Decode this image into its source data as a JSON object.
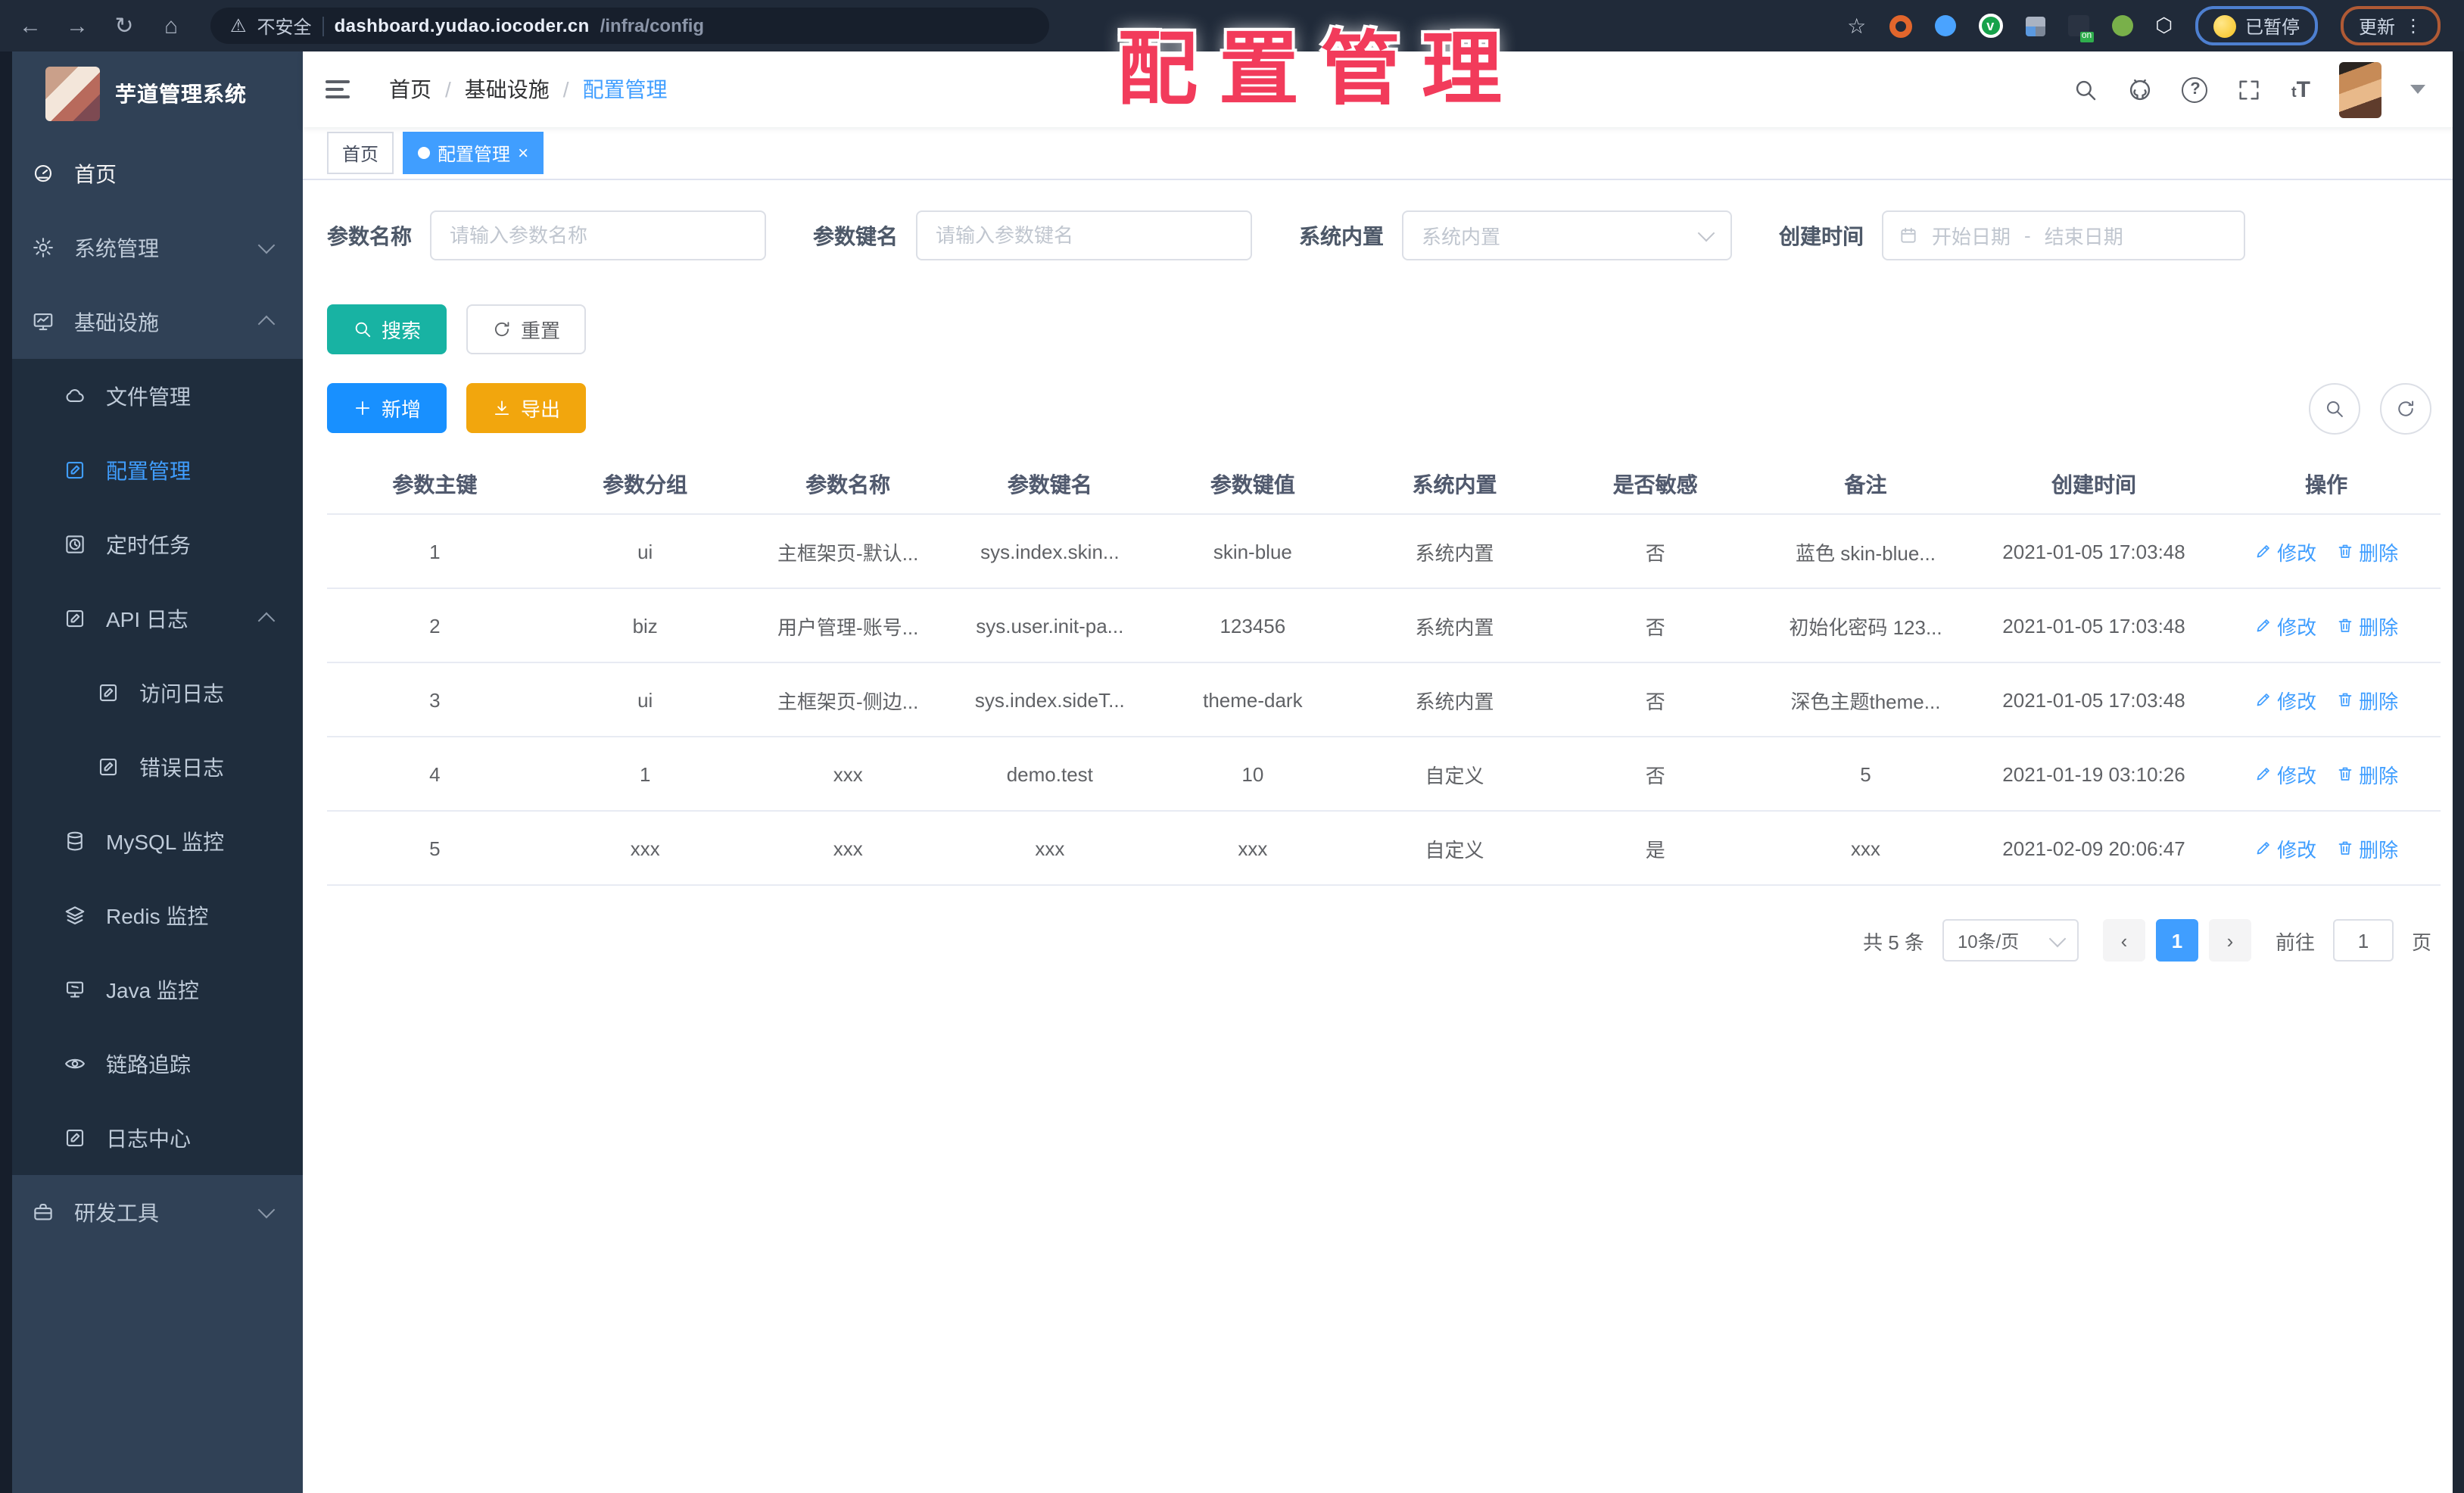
{
  "colors": {
    "accent": "#409eff",
    "search_button": "#18b3a3",
    "add_button": "#1890ff",
    "export_button": "#f2a60d",
    "overlay_red": "#f23b5b",
    "sidebar_bg": "#304156",
    "submenu_bg": "#1f2d3d"
  },
  "browser": {
    "warning": "不安全",
    "host": "dashboard.yudao.iocoder.cn",
    "path": "/infra/config",
    "paused_button": "已暂停",
    "update_button": "更新"
  },
  "overlay": {
    "title": "配置管理"
  },
  "sidebar": {
    "title": "芋道管理系统",
    "items": [
      {
        "label": "首页"
      },
      {
        "label": "系统管理"
      },
      {
        "label": "基础设施"
      },
      {
        "label": "文件管理"
      },
      {
        "label": "配置管理"
      },
      {
        "label": "定时任务"
      },
      {
        "label": "API 日志"
      },
      {
        "label": "访问日志"
      },
      {
        "label": "错误日志"
      },
      {
        "label": "MySQL 监控"
      },
      {
        "label": "Redis 监控"
      },
      {
        "label": "Java 监控"
      },
      {
        "label": "链路追踪"
      },
      {
        "label": "日志中心"
      },
      {
        "label": "研发工具"
      }
    ]
  },
  "breadcrumb": {
    "items": [
      "首页",
      "基础设施",
      "配置管理"
    ]
  },
  "tabs": [
    {
      "label": "首页"
    },
    {
      "label": "配置管理"
    }
  ],
  "filters": {
    "param_name": {
      "label": "参数名称",
      "placeholder": "请输入参数名称"
    },
    "param_key": {
      "label": "参数键名",
      "placeholder": "请输入参数键名"
    },
    "builtin": {
      "label": "系统内置",
      "placeholder": "系统内置"
    },
    "create_time": {
      "label": "创建时间",
      "start": "开始日期",
      "separator": "-",
      "end": "结束日期"
    }
  },
  "toolbar": {
    "search": "搜索",
    "reset": "重置",
    "add": "新增",
    "export": "导出"
  },
  "table": {
    "headers": [
      "参数主键",
      "参数分组",
      "参数名称",
      "参数键名",
      "参数键值",
      "系统内置",
      "是否敏感",
      "备注",
      "创建时间",
      "操作"
    ],
    "op_edit": "修改",
    "op_delete": "删除",
    "rows": [
      {
        "cells": [
          "1",
          "ui",
          "主框架页-默认...",
          "sys.index.skin...",
          "skin-blue",
          "系统内置",
          "否",
          "蓝色 skin-blue...",
          "2021-01-05 17:03:48"
        ]
      },
      {
        "cells": [
          "2",
          "biz",
          "用户管理-账号...",
          "sys.user.init-pa...",
          "123456",
          "系统内置",
          "否",
          "初始化密码 123...",
          "2021-01-05 17:03:48"
        ]
      },
      {
        "cells": [
          "3",
          "ui",
          "主框架页-侧边...",
          "sys.index.sideT...",
          "theme-dark",
          "系统内置",
          "否",
          "深色主题theme...",
          "2021-01-05 17:03:48"
        ]
      },
      {
        "cells": [
          "4",
          "1",
          "xxx",
          "demo.test",
          "10",
          "自定义",
          "否",
          "5",
          "2021-01-19 03:10:26"
        ]
      },
      {
        "cells": [
          "5",
          "xxx",
          "xxx",
          "xxx",
          "xxx",
          "自定义",
          "是",
          "xxx",
          "2021-02-09 20:06:47"
        ]
      }
    ]
  },
  "pagination": {
    "total": "共 5 条",
    "page_size": "10条/页",
    "prev": "‹",
    "current": "1",
    "next": "›",
    "goto_label": "前往",
    "goto_value": "1",
    "page_unit": "页"
  }
}
